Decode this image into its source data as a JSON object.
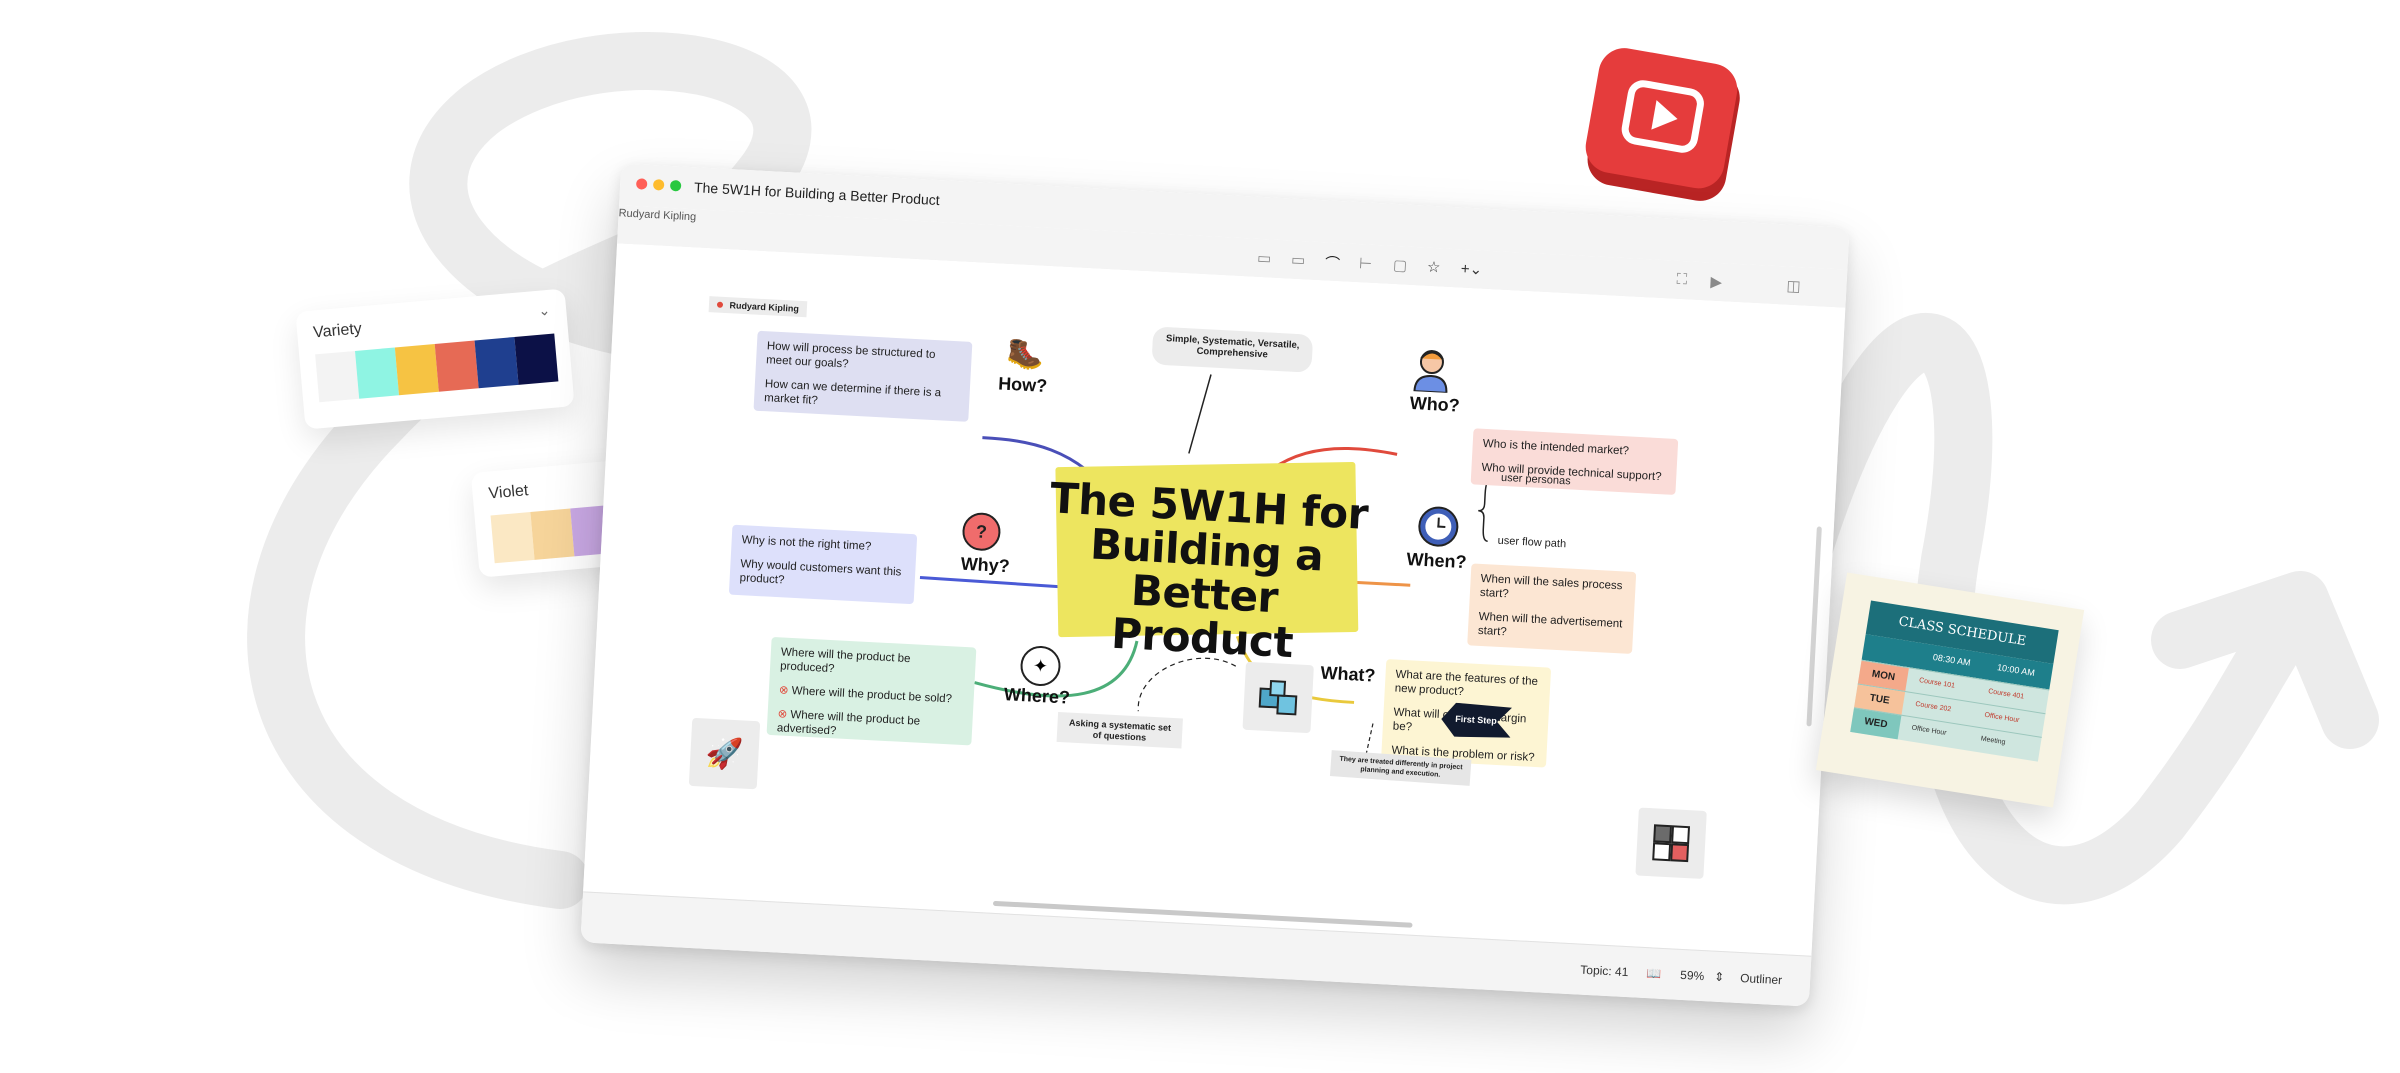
{
  "window": {
    "title": "The 5W1H for Building a Better Product",
    "cut_label": "Rudyard Kipling",
    "traffic_lights": [
      "#ff5f57",
      "#febc2e",
      "#28c840"
    ]
  },
  "toolbar": {
    "icons": [
      "subtopic-icon",
      "topic-icon",
      "relationship-icon",
      "summary-icon",
      "boundary-icon",
      "sticker-icon",
      "insert-icon"
    ],
    "right_icons": [
      "fullscreen-icon",
      "pitch-icon",
      "panel-icon"
    ]
  },
  "map": {
    "center_title": "The 5W1H for Building a Better Product",
    "kipling_tag": "Rudyard Kipling",
    "callout": "Simple, Systematic, Versatile, Comprehensive",
    "how": {
      "label": "How?",
      "items": [
        "How will process be structured to meet our goals?",
        "How can we determine if there is a market fit?"
      ],
      "color": "#4a4fb8",
      "bg": "#dedff2"
    },
    "why": {
      "label": "Why?",
      "items": [
        "Why is not the right time?",
        "Why would customers want this product?"
      ],
      "color": "#4a5ad6",
      "bg": "#dde0fb"
    },
    "where": {
      "label": "Where?",
      "items": [
        "Where will the product be produced?",
        "Where will the product be sold?",
        "Where will the product be advertised?"
      ],
      "color": "#4cae78",
      "bg": "#d9f1e3"
    },
    "who": {
      "label": "Who?",
      "items": [
        "Who is the intended market?",
        "Who will provide technical support?"
      ],
      "color": "#e04a3c",
      "bg": "#fadcd8"
    },
    "when": {
      "label": "When?",
      "items": [
        "When will the sales process start?",
        "When will the advertisement start?"
      ],
      "color": "#ee9448",
      "bg": "#fce6d3"
    },
    "what": {
      "label": "What?",
      "items": [
        "What are the features of the new product?",
        "What will our profit margin be?",
        "What is the problem or risk?"
      ],
      "color": "#e9c93c",
      "bg": "#fdf5d3"
    },
    "who_summary": [
      "user personas",
      "user flow path"
    ],
    "first_step": "First Step",
    "what_note": "They are treated differently in project planning and execution.",
    "questions_note": "Asking a systematic set of questions"
  },
  "status": {
    "topic": "Topic: 41",
    "zoom": "59%",
    "outliner": "Outliner"
  },
  "palettes": {
    "variety": {
      "label": "Variety",
      "colors": [
        "#f3f3f3",
        "#8ff4e3",
        "#f6c343",
        "#e66a55",
        "#1f3f8f",
        "#0c1147"
      ]
    },
    "violet": {
      "label": "Violet",
      "colors": [
        "#fbe8c4",
        "#f6d49a",
        "#c9a8e4"
      ]
    }
  },
  "schedule": {
    "title": "CLASS SCHEDULE",
    "times": [
      "08:30 AM",
      "10:00 AM"
    ],
    "rows": [
      {
        "day": "MON",
        "cells": [
          "Course 101",
          "Course 401"
        ]
      },
      {
        "day": "TUE",
        "cells": [
          "Course 202",
          "Office Hour"
        ]
      },
      {
        "day": "WED",
        "cells": [
          "Office Hour",
          "Meeting"
        ]
      }
    ]
  },
  "colors": {
    "youtube_red": "#e53c3c",
    "center_highlight": "#ede55f"
  }
}
